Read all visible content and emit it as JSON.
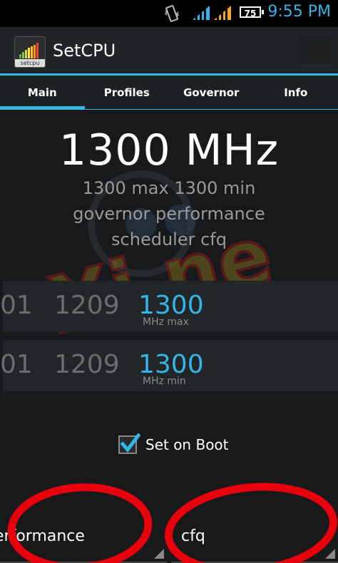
{
  "status_bar": {
    "time": "9:55 PM",
    "battery": "75",
    "icons": [
      "vibrate-icon",
      "signal-icon",
      "signal-icon"
    ],
    "colors": {
      "accent": "#33b5e5",
      "signal_orange": "#f5a623"
    }
  },
  "app": {
    "title": "SetCPU",
    "icon_label": "setcpu"
  },
  "tabs": [
    {
      "label": "Main",
      "active": true
    },
    {
      "label": "Profiles",
      "active": false
    },
    {
      "label": "Governor",
      "active": false
    },
    {
      "label": "Info",
      "active": false
    }
  ],
  "main": {
    "current_frequency": "1300 MHz",
    "summary_line1": "1300 max 1300 min",
    "summary_line2": "governor performance",
    "summary_line3": "scheduler cfq",
    "watermark_text": "Xi  ne",
    "max_picker": {
      "values": [
        "01",
        "1209",
        "1300"
      ],
      "unit": "MHz max"
    },
    "min_picker": {
      "values": [
        "01",
        "1209",
        "1300"
      ],
      "unit": "MHz min"
    },
    "set_on_boot": {
      "label": "Set on Boot",
      "checked": true
    },
    "governor_spinner": "erformance",
    "scheduler_spinner": "cfq"
  }
}
